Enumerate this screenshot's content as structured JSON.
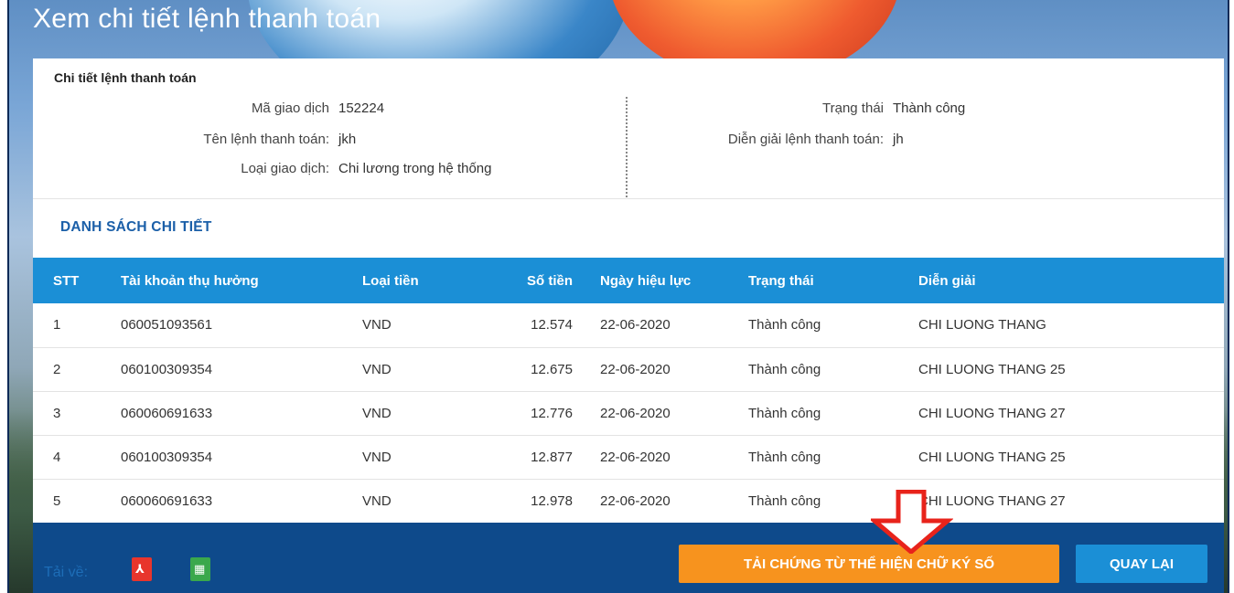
{
  "page_title": "Xem chi tiết lệnh thanh toán",
  "info": {
    "heading": "Chi tiết lệnh thanh toán",
    "left": [
      {
        "label": "Mã giao dịch",
        "value": "152224"
      },
      {
        "label": "Tên lệnh thanh toán:",
        "value": "jkh"
      },
      {
        "label": "Loại giao dịch:",
        "value": "Chi lương trong hệ thống"
      }
    ],
    "right": [
      {
        "label": "Trạng thái",
        "value": "Thành công"
      },
      {
        "label": "Diễn giải lệnh thanh toán:",
        "value": "jh"
      }
    ]
  },
  "details": {
    "title": "DANH SÁCH CHI TIẾT",
    "columns": [
      "STT",
      "Tài khoản thụ hưởng",
      "Loại tiền",
      "Số tiền",
      "Ngày hiệu lực",
      "Trạng thái",
      "Diễn giải"
    ],
    "rows": [
      [
        "1",
        "060051093561",
        "VND",
        "12.574",
        "22-06-2020",
        "Thành công",
        "CHI LUONG THANG"
      ],
      [
        "2",
        "060100309354",
        "VND",
        "12.675",
        "22-06-2020",
        "Thành công",
        "CHI LUONG THANG 25"
      ],
      [
        "3",
        "060060691633",
        "VND",
        "12.776",
        "22-06-2020",
        "Thành công",
        "CHI LUONG THANG 27"
      ],
      [
        "4",
        "060100309354",
        "VND",
        "12.877",
        "22-06-2020",
        "Thành công",
        "CHI LUONG THANG 25"
      ],
      [
        "5",
        "060060691633",
        "VND",
        "12.978",
        "22-06-2020",
        "Thành công",
        "CHI LUONG THANG 27"
      ]
    ]
  },
  "footer": {
    "download_label": "Tải về:",
    "pdf_icon": "pdf-file-icon",
    "excel_icon": "excel-file-icon",
    "sign_button": "TẢI CHỨNG TỪ THỂ HIỆN CHỮ KÝ SỐ",
    "back_button": "QUAY LẠI"
  },
  "colors": {
    "header_blue": "#1b8fd6",
    "footer_navy": "#0e4a8b",
    "accent_orange": "#f7931e",
    "arrow_red": "#e8231b"
  }
}
